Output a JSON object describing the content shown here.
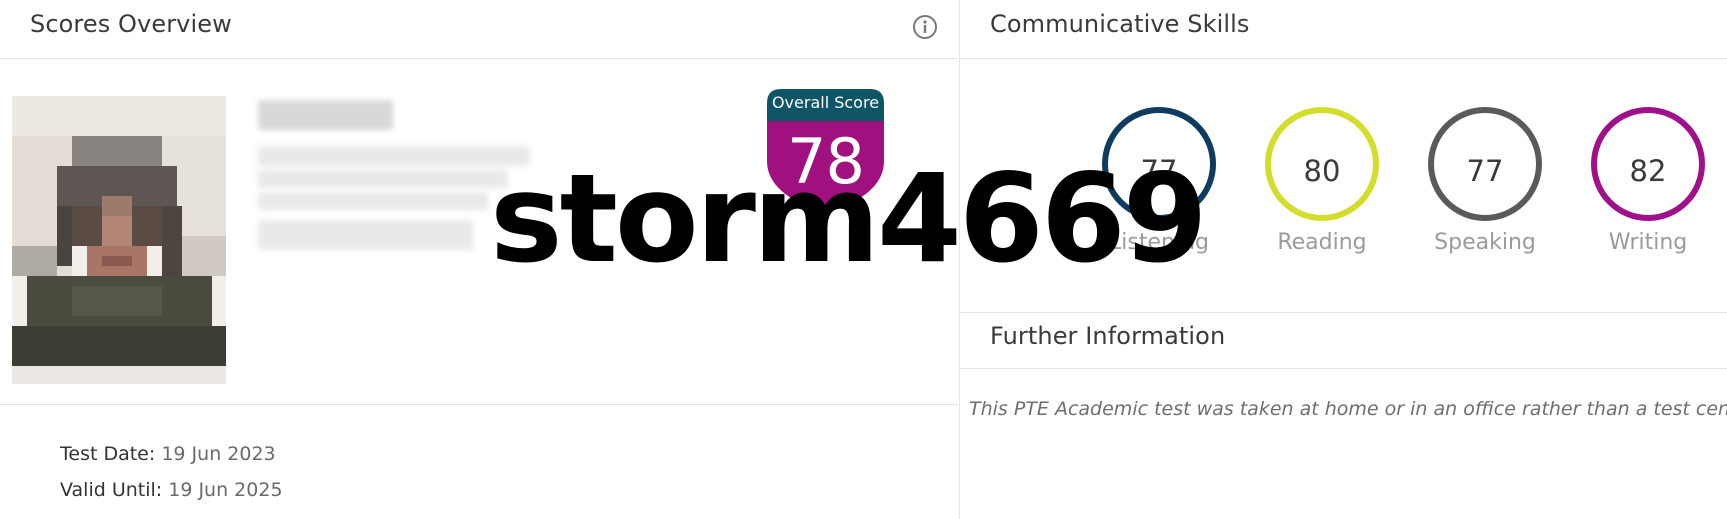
{
  "scores_overview": {
    "title": "Scores Overview",
    "info_icon": "info-circle-icon",
    "overall_score": {
      "label": "Overall Score",
      "value": "78",
      "colors": {
        "label_bg": "#0e5568",
        "value_bg": "#a0107f"
      }
    },
    "test_date": {
      "label": "Test Date",
      "value": "19 Jun 2023"
    },
    "valid_until": {
      "label": "Valid Until",
      "value": "19 Jun 2025"
    }
  },
  "communicative_skills": {
    "title": "Communicative Skills",
    "skills": [
      {
        "name": "Listening",
        "value": "77",
        "color": "#0e3b5e"
      },
      {
        "name": "Reading",
        "value": "80",
        "color": "#d2de2a"
      },
      {
        "name": "Speaking",
        "value": "77",
        "color": "#5a5a5a"
      },
      {
        "name": "Writing",
        "value": "82",
        "color": "#a0108a"
      }
    ]
  },
  "further_information": {
    "title": "Further Information",
    "text": "This PTE Academic test was taken at home or in an office rather than a test center."
  },
  "watermark": "storm4669"
}
